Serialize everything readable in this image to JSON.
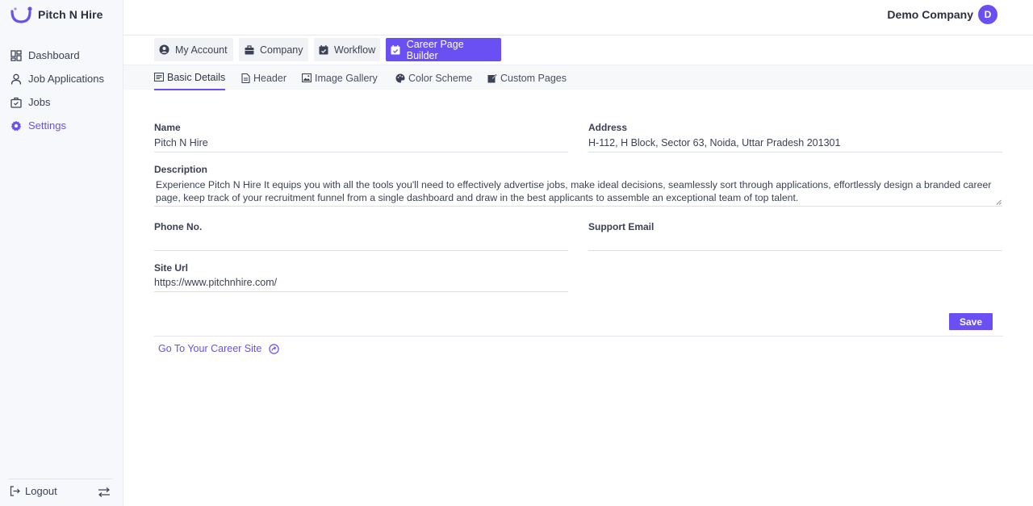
{
  "app": {
    "name": "Pitch N Hire"
  },
  "sidebar": {
    "items": [
      {
        "label": "Dashboard",
        "icon": "dashboard-icon"
      },
      {
        "label": "Job Applications",
        "icon": "user-icon"
      },
      {
        "label": "Jobs",
        "icon": "briefcase-icon"
      },
      {
        "label": "Settings",
        "icon": "gear-icon",
        "active": true
      }
    ],
    "logout_label": "Logout"
  },
  "header": {
    "company_name": "Demo Company",
    "avatar_initial": "D"
  },
  "main_tabs": [
    {
      "label": "My Account",
      "icon": "account-circle-icon"
    },
    {
      "label": "Company",
      "icon": "briefcase-icon"
    },
    {
      "label": "Workflow",
      "icon": "calendar-check-icon"
    },
    {
      "label": "Career Page Builder",
      "icon": "calendar-check-icon",
      "active": true
    }
  ],
  "sub_tabs": [
    {
      "label": "Basic Details",
      "icon": "details-icon",
      "active": true
    },
    {
      "label": "Header",
      "icon": "document-icon"
    },
    {
      "label": "Image Gallery",
      "icon": "image-icon"
    },
    {
      "label": "Color Scheme",
      "icon": "palette-icon"
    },
    {
      "label": "Custom Pages",
      "icon": "edit-page-icon"
    }
  ],
  "form": {
    "name": {
      "label": "Name",
      "value": "Pitch N Hire"
    },
    "address": {
      "label": "Address",
      "value": "H-112, H Block, Sector 63, Noida, Uttar Pradesh 201301"
    },
    "description": {
      "label": "Description",
      "value": "Experience Pitch N Hire It equips you with all the tools you'll need to effectively advertise jobs, make ideal decisions, seamlessly sort through applications, effortlessly design a branded career page, keep track of your recruitment funnel from a single dashboard and draw in the best applicants to assemble an exceptional team of top talent."
    },
    "phone": {
      "label": "Phone No.",
      "value": ""
    },
    "support_email": {
      "label": "Support Email",
      "value": ""
    },
    "site_url": {
      "label": "Site Url",
      "value": "https://www.pitchnhire.com/"
    },
    "save_label": "Save"
  },
  "career_link_label": "Go To Your Career Site",
  "colors": {
    "accent": "#6a4ff2",
    "sidebar_bg": "#f6f8fc"
  }
}
